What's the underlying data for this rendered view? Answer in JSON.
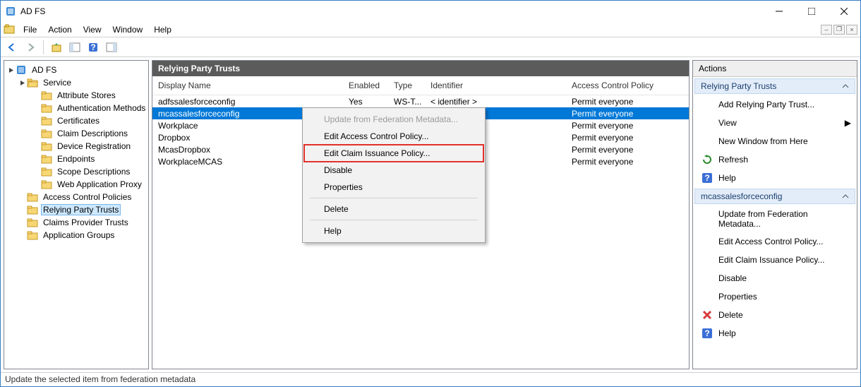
{
  "window": {
    "title": "AD FS"
  },
  "menubar": {
    "items": [
      "File",
      "Action",
      "View",
      "Window",
      "Help"
    ]
  },
  "tree": {
    "root": "AD FS",
    "service": {
      "label": "Service",
      "children": [
        "Attribute Stores",
        "Authentication Methods",
        "Certificates",
        "Claim Descriptions",
        "Device Registration",
        "Endpoints",
        "Scope Descriptions",
        "Web Application Proxy"
      ]
    },
    "siblings": [
      "Access Control Policies",
      "Relying Party Trusts",
      "Claims Provider Trusts",
      "Application Groups"
    ],
    "selected": "Relying Party Trusts"
  },
  "center": {
    "header": "Relying Party Trusts",
    "columns": {
      "name": "Display Name",
      "enabled": "Enabled",
      "type": "Type",
      "identifier": "Identifier",
      "acp": "Access Control Policy"
    },
    "rows": [
      {
        "name": "adfssalesforceconfig",
        "enabled": "Yes",
        "type": "WS-T...",
        "identifier": "< identifier >",
        "acp": "Permit everyone",
        "selected": false
      },
      {
        "name": "mcassalesforceconfig",
        "enabled": "",
        "type": "",
        "identifier": "",
        "acp": "Permit everyone",
        "selected": true
      },
      {
        "name": "Workplace",
        "enabled": "",
        "type": "",
        "identifier": "",
        "acp": "Permit everyone",
        "selected": false
      },
      {
        "name": "Dropbox",
        "enabled": "",
        "type": "",
        "identifier": "",
        "acp": "Permit everyone",
        "selected": false
      },
      {
        "name": "McasDropbox",
        "enabled": "",
        "type": "",
        "identifier": "",
        "acp": "Permit everyone",
        "selected": false
      },
      {
        "name": "WorkplaceMCAS",
        "enabled": "",
        "type": "",
        "identifier": "",
        "acp": "Permit everyone",
        "selected": false
      }
    ]
  },
  "context_menu": [
    {
      "label": "Update from Federation Metadata...",
      "disabled": true
    },
    {
      "label": "Edit Access Control Policy...",
      "disabled": false
    },
    {
      "label": "Edit Claim Issuance Policy...",
      "disabled": false,
      "highlight": true
    },
    {
      "label": "Disable",
      "disabled": false
    },
    {
      "label": "Properties",
      "disabled": false
    },
    {
      "sep": true
    },
    {
      "label": "Delete",
      "disabled": false
    },
    {
      "sep": true
    },
    {
      "label": "Help",
      "disabled": false
    }
  ],
  "actions": {
    "title": "Actions",
    "group1": {
      "header": "Relying Party Trusts",
      "items": [
        {
          "label": "Add Relying Party Trust...",
          "icon": "blank"
        },
        {
          "label": "View",
          "icon": "blank",
          "arrow": true
        },
        {
          "label": "New Window from Here",
          "icon": "blank"
        },
        {
          "label": "Refresh",
          "icon": "refresh"
        },
        {
          "label": "Help",
          "icon": "help"
        }
      ]
    },
    "group2": {
      "header": "mcassalesforceconfig",
      "items": [
        {
          "label": "Update from Federation Metadata...",
          "icon": "blank"
        },
        {
          "label": "Edit Access Control Policy...",
          "icon": "blank"
        },
        {
          "label": "Edit Claim Issuance Policy...",
          "icon": "blank"
        },
        {
          "label": "Disable",
          "icon": "blank"
        },
        {
          "label": "Properties",
          "icon": "blank"
        },
        {
          "label": "Delete",
          "icon": "delete"
        },
        {
          "label": "Help",
          "icon": "help"
        }
      ]
    }
  },
  "statusbar": "Update the selected item from federation metadata"
}
